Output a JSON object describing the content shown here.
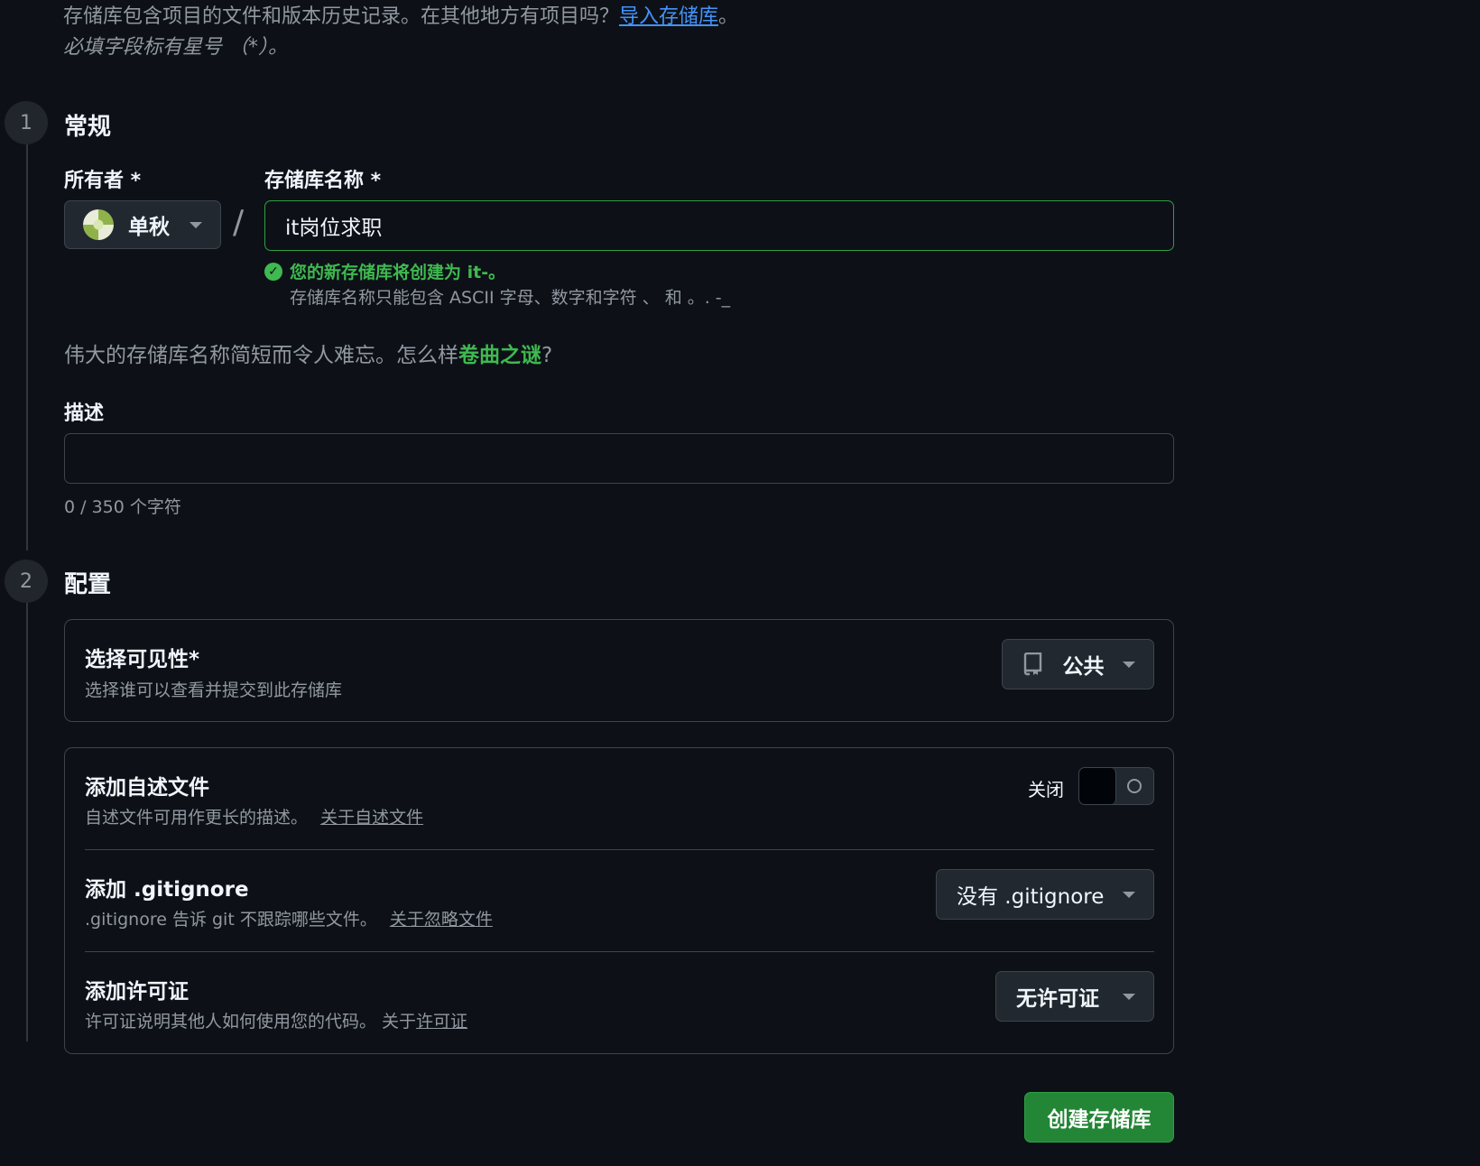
{
  "intro": {
    "text": "存储库包含项目的文件和版本历史记录。在其他地方有项目吗？",
    "import_link": "导入存储库",
    "suffix": "。",
    "required_note": "必填字段标有星号 （*）。"
  },
  "section_general": {
    "step": "1",
    "title": "常规",
    "owner_label": "所有者 *",
    "owner_name": "单秋",
    "separator": "/",
    "repo_name_label": "存储库名称 *",
    "repo_name_value": "it岗位求职",
    "availability_message": "您的新存储库将创建为 it-。",
    "name_hint": "存储库名称只能包含 ASCII 字母、数字和字符 、 和 。. -_",
    "suggestion_prefix": "伟大的存储库名称简短而令人难忘。怎么样",
    "suggestion_name": "卷曲之谜",
    "suggestion_suffix": "?",
    "description_label": "描述",
    "description_value": "",
    "char_count": "0 / 350 个字符"
  },
  "section_config": {
    "step": "2",
    "title": "配置",
    "visibility": {
      "title": "选择可见性*",
      "subtitle": "选择谁可以查看并提交到此存储库",
      "selected": "公共",
      "icon": "repo-icon"
    },
    "readme": {
      "title": "添加自述文件",
      "subtitle": "自述文件可用作更长的描述。",
      "link": "关于自述文件",
      "toggle_label": "关闭",
      "enabled": false
    },
    "gitignore": {
      "title": "添加 .gitignore",
      "subtitle": ".gitignore 告诉 git 不跟踪哪些文件。",
      "link": "关于忽略文件",
      "selected": "没有 .gitignore"
    },
    "license": {
      "title": "添加许可证",
      "subtitle": "许可证说明其他人如何使用您的代码。 关于",
      "link": "许可证",
      "selected": "无许可证"
    }
  },
  "create_button": "创建存储库",
  "colors": {
    "background": "#0d1117",
    "accent_green": "#3fb950",
    "button_green": "#238636",
    "link_blue": "#4493f8",
    "border": "#3d444d"
  }
}
